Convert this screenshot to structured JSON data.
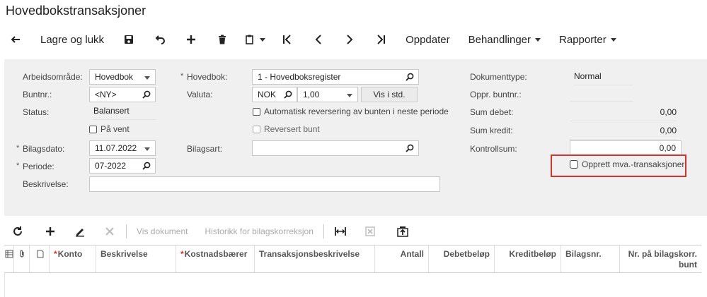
{
  "page": {
    "title": "Hovedbokstransaksjoner"
  },
  "toolbar": {
    "save_close": "Lagre og lukk",
    "refresh_label": "Oppdater",
    "actions_label": "Behandlinger",
    "reports_label": "Rapporter"
  },
  "form": {
    "workspace": {
      "label": "Arbeidsområde:",
      "value": "Hovedbok"
    },
    "batch_no": {
      "label": "Buntnr.:",
      "value": "<NY>"
    },
    "status": {
      "label": "Status:",
      "value": "Balansert"
    },
    "on_hold": {
      "label": "På vent",
      "checked": false
    },
    "ledger": {
      "label": "Hovedbok:",
      "value": "1 - Hovedboksregister"
    },
    "currency": {
      "label": "Valuta:",
      "code": "NOK",
      "rate": "1,00",
      "view_base": "Vis i std."
    },
    "auto_reverse": {
      "label": "Automatisk reversering av bunten i neste periode",
      "checked": false
    },
    "reversed": {
      "label": "Reversert bunt",
      "checked": false
    },
    "transaction_date": {
      "label": "Bilagsdato:",
      "value": "11.07.2022"
    },
    "voucher_type": {
      "label": "Bilagsart:",
      "value": ""
    },
    "period": {
      "label": "Periode:",
      "value": "07-2022"
    },
    "description": {
      "label": "Beskrivelse:",
      "value": ""
    },
    "doc_type": {
      "label": "Dokumenttype:",
      "value": "Normal"
    },
    "orig_batch": {
      "label": "Oppr. buntnr.:",
      "value": ""
    },
    "debit_total": {
      "label": "Sum debet:",
      "value": "0,00"
    },
    "credit_total": {
      "label": "Sum kredit:",
      "value": "0,00"
    },
    "control_total": {
      "label": "Kontrollsum:",
      "value": "0,00"
    },
    "create_vat": {
      "label": "Opprett mva.-transaksjoner",
      "checked": false
    }
  },
  "grid_toolbar": {
    "view_document": "Vis dokument",
    "correction_history": "Historikk for bilagskorreksjon"
  },
  "grid": {
    "columns": [
      {
        "label": "Konto",
        "required": true
      },
      {
        "label": "Beskrivelse",
        "required": false
      },
      {
        "label": "Kostnadsbærer",
        "required": true
      },
      {
        "label": "Transaksjonsbeskrivelse",
        "required": false
      },
      {
        "label": "Antall",
        "required": false
      },
      {
        "label": "Debetbeløp",
        "required": false
      },
      {
        "label": "Kreditbeløp",
        "required": false
      },
      {
        "label": "Bilagsnr.",
        "required": false
      },
      {
        "label": "Nr. på bilagskorr. bunt",
        "required": false
      }
    ]
  },
  "colors": {
    "highlight": "#d9312b",
    "form_bg": "#f0f0f0"
  }
}
